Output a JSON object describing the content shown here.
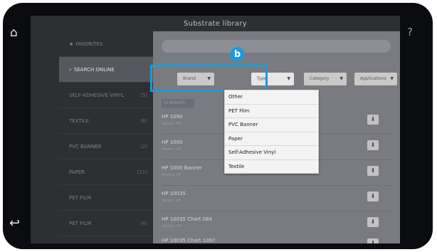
{
  "window": {
    "title": "Substrate library"
  },
  "nav": {
    "home_icon": "home-icon",
    "back_icon": "back-arrow-icon",
    "help_label": "?",
    "prev_icon": "chevron-left-icon",
    "next_icon": "chevron-right-icon"
  },
  "sidebar": {
    "items": [
      {
        "label": "FAVORITES",
        "count": ""
      },
      {
        "label": "SEARCH ONLINE",
        "count": ""
      },
      {
        "label": "SELF-ADHESIVE VINYL",
        "count": "(5)"
      },
      {
        "label": "TEXTILE",
        "count": "(6)"
      },
      {
        "label": "PVC BANNER",
        "count": "(2)"
      },
      {
        "label": "PAPER",
        "count": "(11)"
      },
      {
        "label": "PET FILM",
        "count": ""
      },
      {
        "label": "PET FILM",
        "count": "(4)"
      }
    ]
  },
  "filters": {
    "brand": "Brand",
    "type": "Type",
    "category": "Category",
    "applications": "Applications"
  },
  "results": {
    "header": "10 RESULTS",
    "rows": [
      {
        "name": "HP 1090",
        "sub": "Vendor: HP"
      },
      {
        "name": "HP 1000",
        "sub": "Vendor: HP"
      },
      {
        "name": "HP 1000 Banner",
        "sub": "Vendor: HP"
      },
      {
        "name": "HP 10035",
        "sub": "Vendor: HP"
      },
      {
        "name": "HP 10035 Chart 084",
        "sub": "Vendor: HP"
      },
      {
        "name": "HP 10035 Chart 1097",
        "sub": ""
      }
    ]
  },
  "type_dropdown": {
    "options": [
      "Other",
      "PET Film",
      "PVC Banner",
      "Paper",
      "Self-Adhesive Vinyl",
      "Textile"
    ]
  },
  "callout": {
    "label": "b",
    "color": "#1e9ad6"
  }
}
